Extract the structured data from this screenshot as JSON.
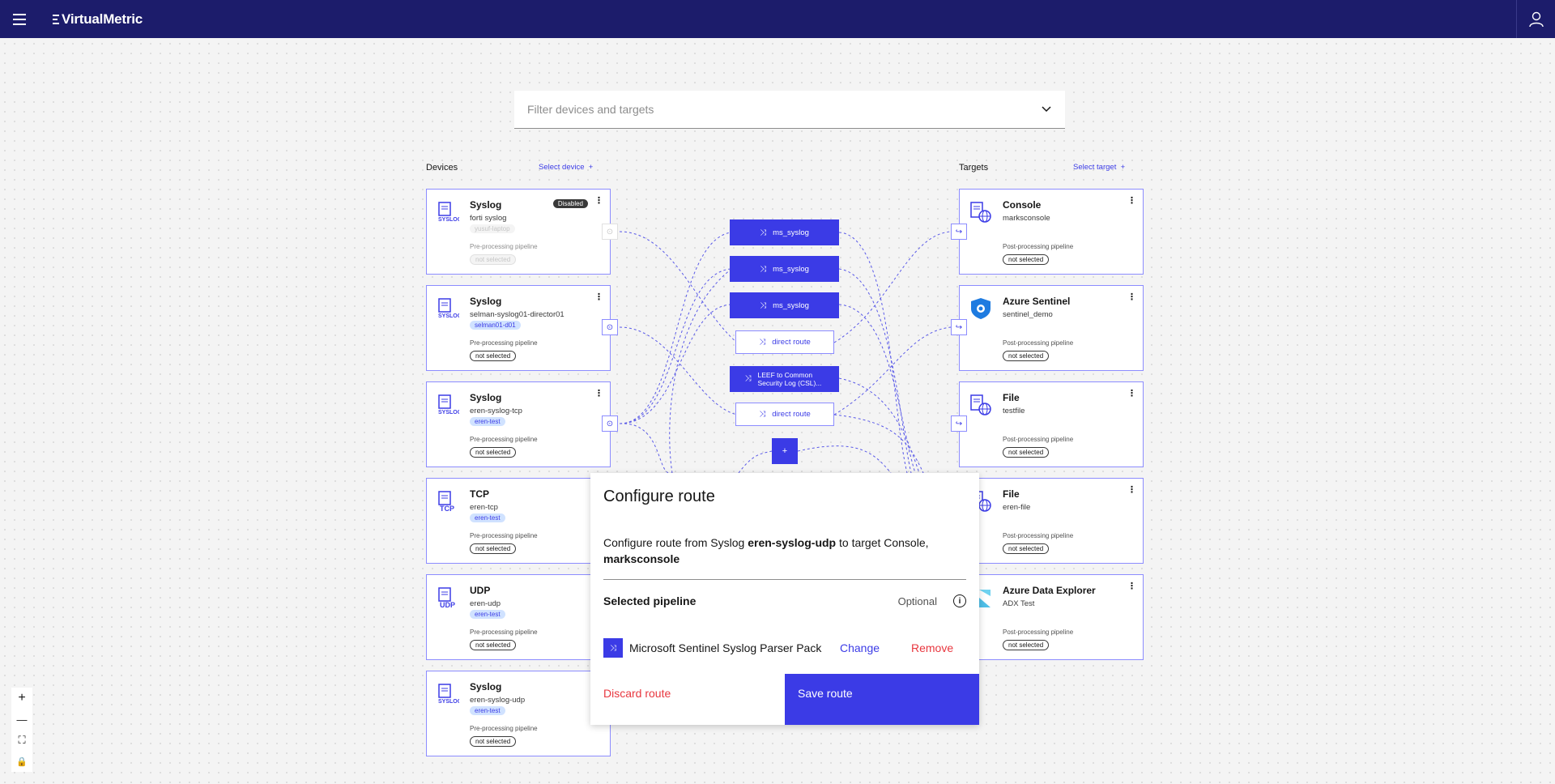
{
  "app": {
    "name": "VirtualMetric"
  },
  "filter": {
    "placeholder": "Filter devices and targets"
  },
  "devices": {
    "heading": "Devices",
    "select_label": "Select device",
    "items": [
      {
        "title": "Syslog",
        "subtitle": "forti syslog",
        "tag": "yusuf-laptop",
        "pp_label": "Pre-processing pipeline",
        "pp_value": "not selected",
        "disabled": "Disabled"
      },
      {
        "title": "Syslog",
        "subtitle": "selman-syslog01-director01",
        "tag": "selman01-d01",
        "pp_label": "Pre-processing pipeline",
        "pp_value": "not selected"
      },
      {
        "title": "Syslog",
        "subtitle": "eren-syslog-tcp",
        "tag": "eren-test",
        "pp_label": "Pre-processing pipeline",
        "pp_value": "not selected"
      },
      {
        "title": "TCP",
        "subtitle": "eren-tcp",
        "tag": "eren-test",
        "pp_label": "Pre-processing pipeline",
        "pp_value": "not selected"
      },
      {
        "title": "UDP",
        "subtitle": "eren-udp",
        "tag": "eren-test",
        "pp_label": "Pre-processing pipeline",
        "pp_value": "not selected"
      },
      {
        "title": "Syslog",
        "subtitle": "eren-syslog-udp",
        "tag": "eren-test",
        "pp_label": "Pre-processing pipeline",
        "pp_value": "not selected"
      }
    ]
  },
  "targets": {
    "heading": "Targets",
    "select_label": "Select target",
    "items": [
      {
        "title": "Console",
        "subtitle": "marksconsole",
        "pp_label": "Post-processing pipeline",
        "pp_value": "not selected"
      },
      {
        "title": "Azure Sentinel",
        "subtitle": "sentinel_demo",
        "pp_label": "Post-processing pipeline",
        "pp_value": "not selected"
      },
      {
        "title": "File",
        "subtitle": "testfile",
        "pp_label": "Post-processing pipeline",
        "pp_value": "not selected"
      },
      {
        "title": "File",
        "subtitle": "eren-file",
        "pp_label": "Post-processing pipeline",
        "pp_value": "not selected"
      },
      {
        "title": "Azure Data Explorer",
        "subtitle": "ADX Test",
        "pp_label": "Post-processing pipeline",
        "pp_value": "not selected"
      }
    ]
  },
  "routes": [
    {
      "label": "ms_syslog",
      "style": "filled"
    },
    {
      "label": "ms_syslog",
      "style": "filled"
    },
    {
      "label": "ms_syslog",
      "style": "filled"
    },
    {
      "label": "direct route",
      "style": "outline"
    },
    {
      "label": "LEEF to Common Security Log (CSL)...",
      "style": "filled"
    },
    {
      "label": "direct route",
      "style": "outline"
    }
  ],
  "add_route": "+",
  "zoom": {
    "in": "+",
    "out": "—",
    "fit": "⛶",
    "lock": "🔒"
  },
  "modal": {
    "title": "Configure route",
    "desc_prefix": "Configure route from Syslog ",
    "desc_source": "eren-syslog-udp",
    "desc_middle": " to target Console, ",
    "desc_target": "marksconsole",
    "selected_pipeline_label": "Selected pipeline",
    "optional": "Optional",
    "pipeline_name": "Microsoft Sentinel Syslog Parser Pack",
    "change": "Change",
    "remove": "Remove",
    "discard": "Discard route",
    "save": "Save route"
  },
  "colors": {
    "header": "#1c1c6b",
    "accent": "#3b3be6",
    "danger": "#e8373f"
  }
}
